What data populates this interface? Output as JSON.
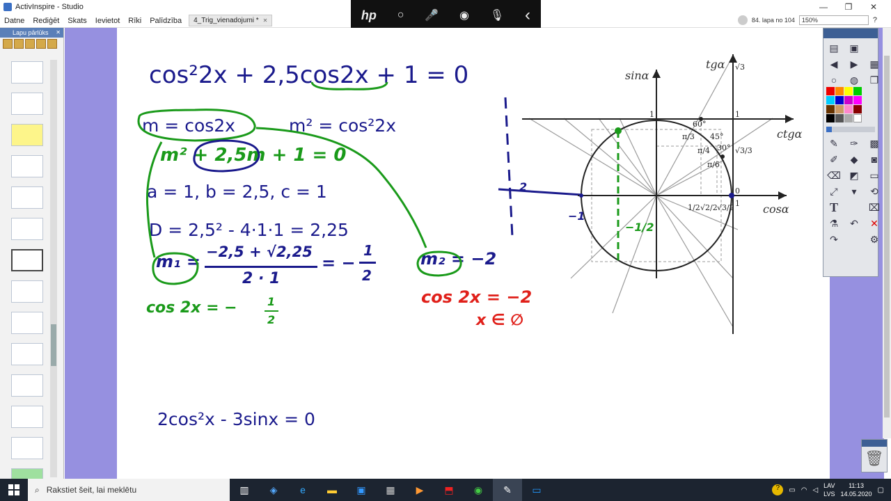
{
  "window": {
    "title": "ActivInspire - Studio",
    "minimize": "—",
    "maximize": "❐",
    "close": "✕"
  },
  "recorder": {
    "brand": "hp",
    "icon_dot": "○",
    "icon_mic": "🎤",
    "icon_record": "◉",
    "icon_mic2": "🎙",
    "icon_back": "‹"
  },
  "menu": {
    "items": [
      "Datne",
      "Rediģēt",
      "Skats",
      "Ievietot",
      "Rīki",
      "Palīdzība"
    ],
    "doc_tab": "4_Trig_vienadojumi *",
    "doc_tab_close": "✕"
  },
  "page": {
    "counter": "84. lapa no 104",
    "zoom": "150%"
  },
  "left_panel": {
    "title": "Lapu pārlūks",
    "close": "✕"
  },
  "canvas": {
    "eq_main": "cos²2x + 2,5cos2x + 1 = 0",
    "eq_sub": "m = cos2x",
    "eq_sub2": "m² = cos²2x",
    "hand_quadratic": "m² + 2,5m + 1 = 0",
    "eq_abc": "a = 1, b = 2,5, c = 1",
    "eq_disc": "D = 2,5² - 4·1·1 = 2,25",
    "hand_m1": "m₁ =",
    "hand_frac_num": "−2,5 + √2,25",
    "hand_frac_den": "2 · 1",
    "hand_m1_result": "= −",
    "hand_half_num": "1",
    "hand_half_den": "2",
    "hand_m2": "m₂ = −2",
    "hand_cos_eq": "cos 2x = −",
    "hand_red_eq": "cos 2x = −2",
    "hand_red_sol": "x ∈ ∅",
    "eq_bottom": "2cos²x - 3sinx = 0"
  },
  "unit_circle": {
    "sin_label": "sinα",
    "cos_label": "cosα",
    "tg_label": "tgα",
    "ctg_label": "ctgα",
    "sqrt3": "√3",
    "one_top": "1",
    "one_right_top": "1",
    "zero": "0",
    "one_axis": "1",
    "deg60": "60°",
    "deg45": "45°",
    "deg30": "30°",
    "pi3": "π/3",
    "pi4": "π/4",
    "pi6": "π/6",
    "sqrt3_3": "√3/3",
    "half": "1/2",
    "sqrt2_2": "√2/2",
    "sqrt3_2": "√3/2",
    "hand_left_2": "2",
    "hand_minus1": "−1",
    "hand_minus_half": "−1/2"
  },
  "taskbar": {
    "search_placeholder": "Rakstiet šeit, lai meklētu",
    "lang_top": "LAV",
    "lang_bottom": "LVS",
    "time": "11:13",
    "date": "14.05.2020"
  },
  "colors": {
    "accent_purple": "#9690e0",
    "ink_blue": "#1a1a8c",
    "ink_green": "#1a9a1a",
    "ink_red": "#e0201a"
  }
}
